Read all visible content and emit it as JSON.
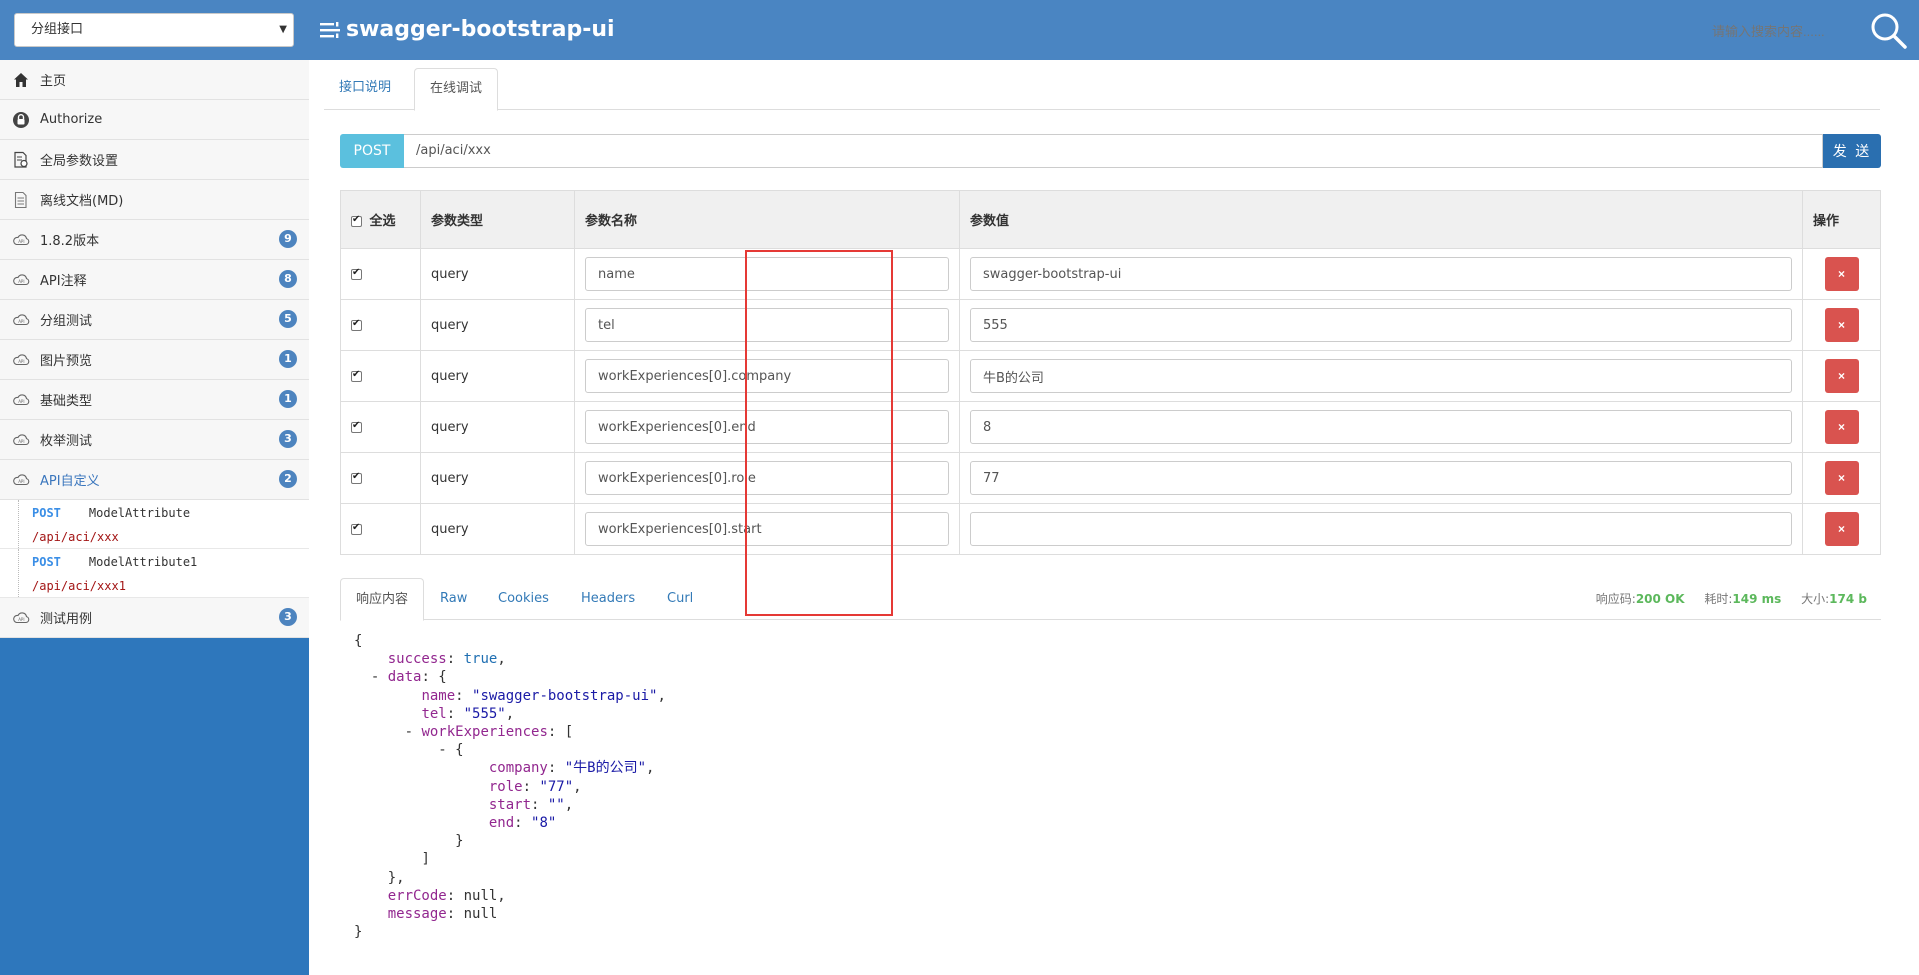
{
  "header": {
    "group_select": "分组接口",
    "app_title": "swagger-bootstrap-ui",
    "search_placeholder": "请输入搜索内容......"
  },
  "sidebar": {
    "items": [
      {
        "label": "主页",
        "icon": "home-icon"
      },
      {
        "label": "Authorize",
        "icon": "lock-icon"
      },
      {
        "label": "全局参数设置",
        "icon": "settings-doc-icon"
      },
      {
        "label": "离线文档(MD)",
        "icon": "document-icon"
      },
      {
        "label": "1.8.2版本",
        "icon": "cloud-icon",
        "badge": "9"
      },
      {
        "label": "API注释",
        "icon": "cloud-icon",
        "badge": "8"
      },
      {
        "label": "分组测试",
        "icon": "cloud-icon",
        "badge": "5"
      },
      {
        "label": "图片预览",
        "icon": "cloud-icon",
        "badge": "1"
      },
      {
        "label": "基础类型",
        "icon": "cloud-icon",
        "badge": "1"
      },
      {
        "label": "枚举测试",
        "icon": "cloud-icon",
        "badge": "3"
      },
      {
        "label": "API自定义",
        "icon": "cloud-icon",
        "badge": "2",
        "active": true
      }
    ],
    "sub_items": [
      {
        "method": "POST",
        "name": "ModelAttribute",
        "path": "/api/aci/xxx"
      },
      {
        "method": "POST",
        "name": "ModelAttribute1",
        "path": "/api/aci/xxx1"
      }
    ],
    "last_item": {
      "label": "测试用例",
      "icon": "cloud-icon",
      "badge": "3"
    }
  },
  "tabs": {
    "doc": "接口说明",
    "debug": "在线调试"
  },
  "request": {
    "method": "POST",
    "url": "/api/aci/xxx",
    "send_label": "发 送"
  },
  "params": {
    "headers": {
      "select_all": "全选",
      "type": "参数类型",
      "name": "参数名称",
      "value": "参数值",
      "action": "操作"
    },
    "rows": [
      {
        "type": "query",
        "name": "name",
        "value": "swagger-bootstrap-ui"
      },
      {
        "type": "query",
        "name": "tel",
        "value": "555"
      },
      {
        "type": "query",
        "name": "workExperiences[0].company",
        "value": "牛B的公司"
      },
      {
        "type": "query",
        "name": "workExperiences[0].end",
        "value": "8"
      },
      {
        "type": "query",
        "name": "workExperiences[0].role",
        "value": "77"
      },
      {
        "type": "query",
        "name": "workExperiences[0].start",
        "value": ""
      }
    ],
    "delete_label": "×"
  },
  "response": {
    "tabs": [
      "响应内容",
      "Raw",
      "Cookies",
      "Headers",
      "Curl"
    ],
    "status_label": "响应码:",
    "status_value": "200 OK",
    "time_label": "耗时:",
    "time_value": "149 ms",
    "size_label": "大小:",
    "size_value": "174 b",
    "lines": [
      {
        "indent": 0,
        "parts": [
          [
            "n",
            "{"
          ]
        ]
      },
      {
        "indent": 1,
        "parts": [
          [
            "k",
            "success"
          ],
          [
            "n",
            ": "
          ],
          [
            "b",
            "true"
          ],
          [
            "n",
            ","
          ]
        ]
      },
      {
        "indent": 1,
        "fold": true,
        "parts": [
          [
            "k",
            "data"
          ],
          [
            "n",
            ": {"
          ]
        ]
      },
      {
        "indent": 2,
        "parts": [
          [
            "k",
            "name"
          ],
          [
            "n",
            ": "
          ],
          [
            "s",
            "\"swagger-bootstrap-ui\""
          ],
          [
            "n",
            ","
          ]
        ]
      },
      {
        "indent": 2,
        "parts": [
          [
            "k",
            "tel"
          ],
          [
            "n",
            ": "
          ],
          [
            "s",
            "\"555\""
          ],
          [
            "n",
            ","
          ]
        ]
      },
      {
        "indent": 2,
        "fold": true,
        "parts": [
          [
            "k",
            "workExperiences"
          ],
          [
            "n",
            ": ["
          ]
        ]
      },
      {
        "indent": 3,
        "fold": true,
        "parts": [
          [
            "n",
            "{"
          ]
        ]
      },
      {
        "indent": 4,
        "parts": [
          [
            "k",
            "company"
          ],
          [
            "n",
            ": "
          ],
          [
            "s",
            "\"牛B的公司\""
          ],
          [
            "n",
            ","
          ]
        ]
      },
      {
        "indent": 4,
        "parts": [
          [
            "k",
            "role"
          ],
          [
            "n",
            ": "
          ],
          [
            "s",
            "\"77\""
          ],
          [
            "n",
            ","
          ]
        ]
      },
      {
        "indent": 4,
        "parts": [
          [
            "k",
            "start"
          ],
          [
            "n",
            ": "
          ],
          [
            "s",
            "\"\""
          ],
          [
            "n",
            ","
          ]
        ]
      },
      {
        "indent": 4,
        "parts": [
          [
            "k",
            "end"
          ],
          [
            "n",
            ": "
          ],
          [
            "s",
            "\"8\""
          ]
        ]
      },
      {
        "indent": 3,
        "parts": [
          [
            "n",
            "}"
          ]
        ]
      },
      {
        "indent": 2,
        "parts": [
          [
            "n",
            "]"
          ]
        ]
      },
      {
        "indent": 1,
        "parts": [
          [
            "n",
            "},"
          ]
        ]
      },
      {
        "indent": 1,
        "parts": [
          [
            "k",
            "errCode"
          ],
          [
            "n",
            ": null,"
          ]
        ]
      },
      {
        "indent": 1,
        "parts": [
          [
            "k",
            "message"
          ],
          [
            "n",
            ": null"
          ]
        ]
      },
      {
        "indent": 0,
        "parts": [
          [
            "n",
            "}"
          ]
        ]
      }
    ]
  }
}
